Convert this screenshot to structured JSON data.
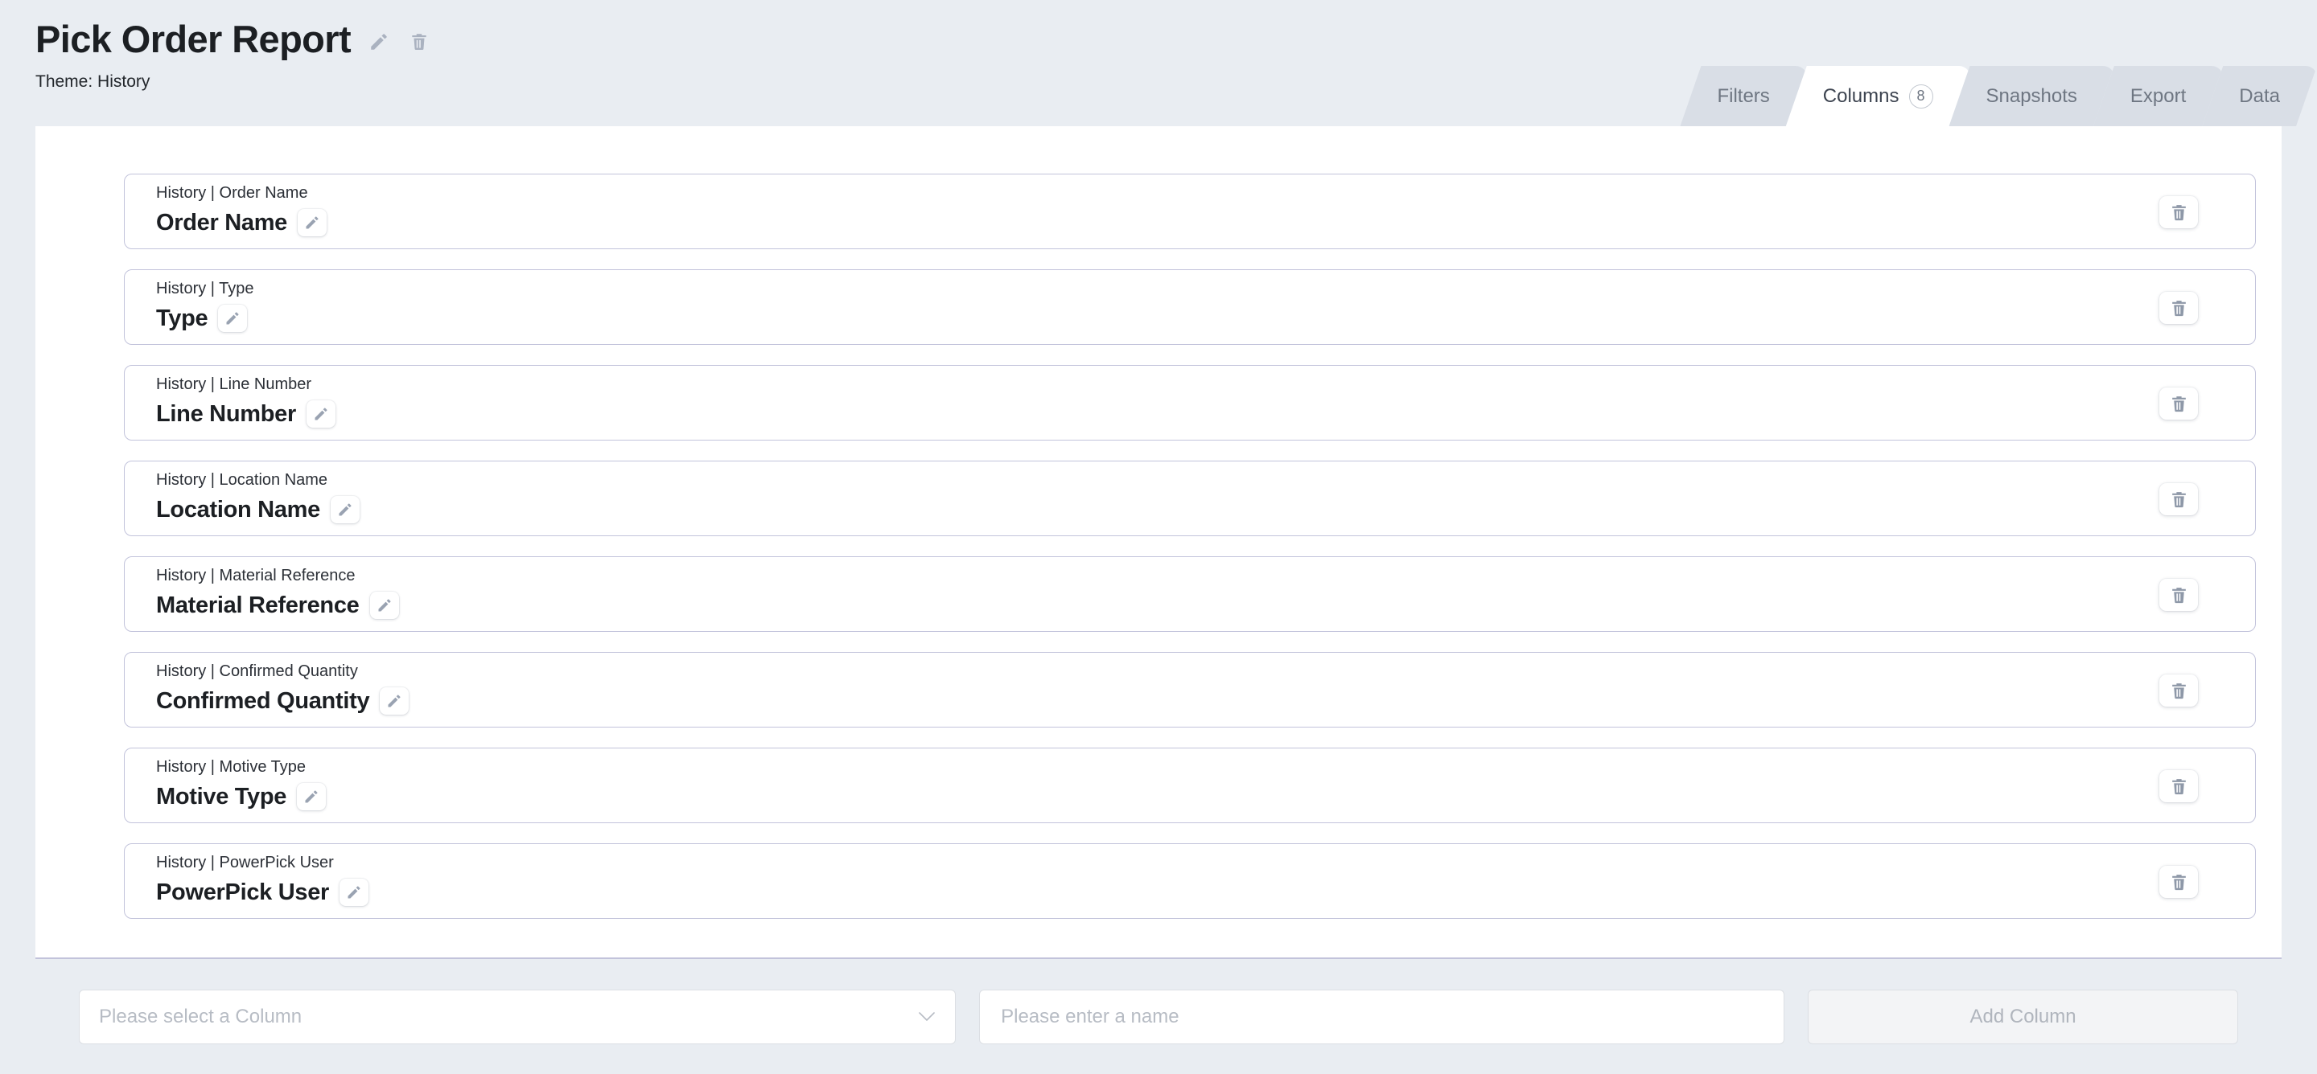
{
  "header": {
    "title": "Pick Order Report",
    "edit_icon": "pencil-icon",
    "delete_icon": "trash-icon",
    "theme_line": "Theme: History"
  },
  "tabs": [
    {
      "label": "Filters",
      "active": false,
      "badge": null
    },
    {
      "label": "Columns",
      "active": true,
      "badge": "8"
    },
    {
      "label": "Snapshots",
      "active": false,
      "badge": null
    },
    {
      "label": "Export",
      "active": false,
      "badge": null
    },
    {
      "label": "Data",
      "active": false,
      "badge": null
    }
  ],
  "columns": [
    {
      "source": "History | Order Name",
      "name": "Order Name"
    },
    {
      "source": "History | Type",
      "name": "Type"
    },
    {
      "source": "History | Line Number",
      "name": "Line Number"
    },
    {
      "source": "History | Location Name",
      "name": "Location Name"
    },
    {
      "source": "History | Material Reference",
      "name": "Material Reference"
    },
    {
      "source": "History | Confirmed Quantity",
      "name": "Confirmed Quantity"
    },
    {
      "source": "History | Motive Type",
      "name": "Motive Type"
    },
    {
      "source": "History | PowerPick User",
      "name": "PowerPick User"
    }
  ],
  "row_icons": {
    "edit": "pencil-icon",
    "delete": "trash-icon"
  },
  "footer": {
    "select_placeholder": "Please select a Column",
    "select_value": "",
    "chevron": "chevron-down-icon",
    "name_placeholder": "Please enter a name",
    "name_value": "",
    "add_button_label": "Add Column",
    "add_button_disabled": true
  },
  "colors": {
    "page_background": "#e9edf2",
    "panel_background": "#ffffff",
    "card_border": "#c2c3db",
    "tab_inactive": "#d9dee6",
    "tab_active": "#ffffff",
    "icon_grey": "#aab2c0",
    "muted_text": "#b7bcc4"
  }
}
